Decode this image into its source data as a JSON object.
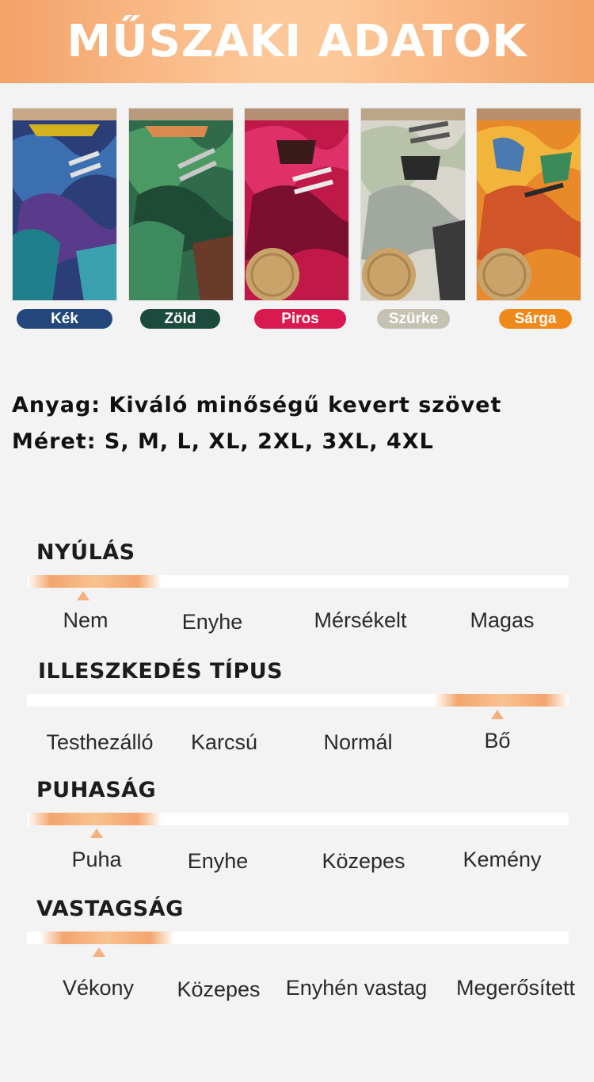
{
  "header": {
    "title": "MŰSZAKI ADATOK"
  },
  "colors": [
    {
      "label": "Kék",
      "color": "#24477b"
    },
    {
      "label": "Zöld",
      "color": "#1c4a3c"
    },
    {
      "label": "Piros",
      "color": "#d91a50"
    },
    {
      "label": "Szürke",
      "color": "#c5c2b4"
    },
    {
      "label": "Sárga",
      "color": "#f0891b"
    }
  ],
  "specs": {
    "material": "Anyag: Kiváló minőségű kevert szövet",
    "size": "Méret: S, M, L, XL, 2XL, 3XL, 4XL"
  },
  "scales": [
    {
      "title": "NYÚLÁS",
      "options": [
        "Nem",
        "Enyhe",
        "Mérsékelt",
        "Magas"
      ],
      "selected": "Nem"
    },
    {
      "title": "ILLESZKEDÉS TÍPUS",
      "options": [
        "Testhezálló",
        "Karcsú",
        "Normál",
        "Bő"
      ],
      "selected": "Bő"
    },
    {
      "title": "PUHASÁG",
      "options": [
        "Puha",
        "Enyhe",
        "Közepes",
        "Kemény"
      ],
      "selected": "Puha"
    },
    {
      "title": "VASTAGSÁG",
      "options": [
        "Vékony",
        "Közepes",
        "Enyhén vastag",
        "Megerősített"
      ],
      "selected": "Vékony"
    }
  ]
}
